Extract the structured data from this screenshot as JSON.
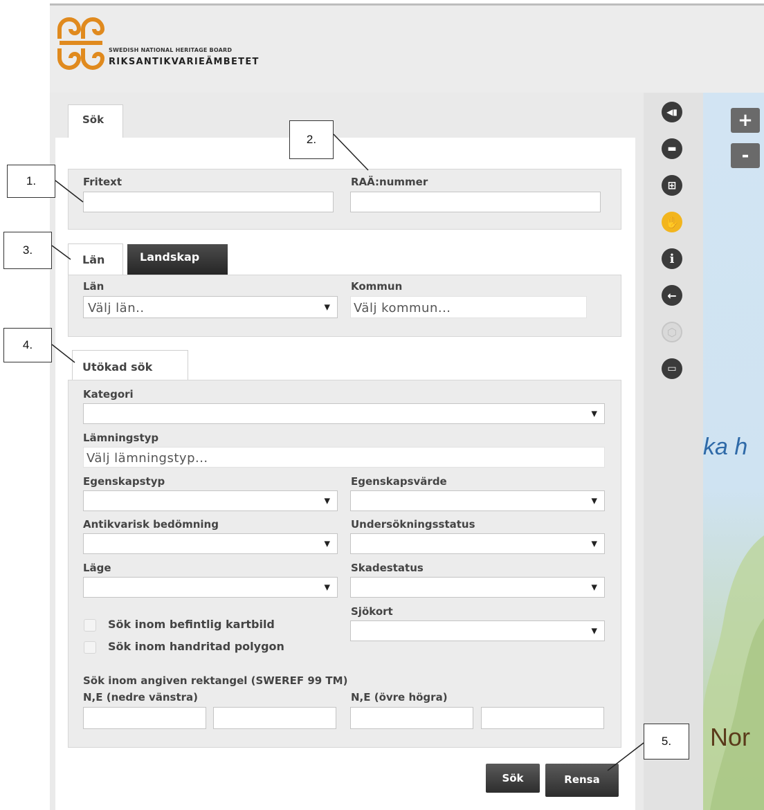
{
  "header": {
    "brand_line1": "SWEDISH NATIONAL HERITAGE BOARD",
    "brand_line2": "RIKSANTIKVARIEÄMBETET",
    "logo_color": "#e08a1e"
  },
  "tabs": {
    "search": "Sök"
  },
  "basic": {
    "fritext_label": "Fritext",
    "raa_label": "RAÄ:nummer"
  },
  "region": {
    "tab_lan": "Län",
    "tab_landskap": "Landskap",
    "lan_label": "Län",
    "lan_value": "Välj län..",
    "kommun_label": "Kommun",
    "kommun_placeholder": "Välj kommun..."
  },
  "advanced": {
    "tab_label": "Utökad sök",
    "kategori_label": "Kategori",
    "lamningstyp_label": "Lämningstyp",
    "lamningstyp_placeholder": "Välj lämningstyp...",
    "egenskapstyp_label": "Egenskapstyp",
    "egenskapsvarde_label": "Egenskapsvärde",
    "antikvarisk_label": "Antikvarisk bedömning",
    "undersokning_label": "Undersökningsstatus",
    "lage_label": "Läge",
    "skadestatus_label": "Skadestatus",
    "sjokort_label": "Sjökort",
    "cb_befintlig": "Sök inom befintlig kartbild",
    "cb_polygon": "Sök inom handritad polygon",
    "rect_title": "Sök inom angiven rektangel (SWEREF 99 TM)",
    "ne_lower": "N,E (nedre vänstra)",
    "ne_upper": "N,E (övre högra)"
  },
  "buttons": {
    "search": "Sök",
    "clear": "Rensa"
  },
  "toolbar": {
    "tools": [
      "collapse-panel-icon",
      "ruler-icon",
      "add-layer-icon",
      "hand-pan-icon",
      "info-icon",
      "back-arrow-icon",
      "polygon-icon",
      "print-icon"
    ],
    "active_color": "#f2b51e"
  },
  "map": {
    "zoom_in": "+",
    "zoom_out": "-",
    "label_sea": "ka h",
    "label_country": "Nor"
  },
  "callouts": [
    "1.",
    "2.",
    "3.",
    "4.",
    "5."
  ]
}
